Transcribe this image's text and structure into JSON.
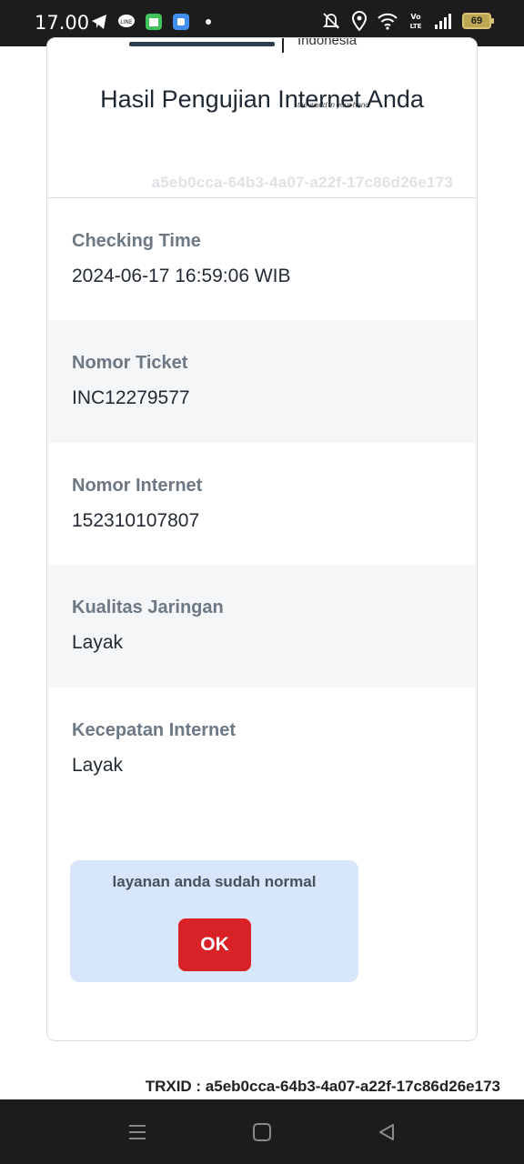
{
  "status_bar": {
    "time": "17.00",
    "battery": "69",
    "icons": [
      "telegram-icon",
      "line-icon",
      "calendar-app-icon",
      "app-icon",
      "dot-icon",
      "mute-icon",
      "location-icon",
      "wifi-icon",
      "volte-icon",
      "signal-icon",
      "battery-icon"
    ]
  },
  "card": {
    "title": "Hasil Pengujian Internet Anda",
    "logo_word": "Indonesia",
    "tagline": "the world in your hand",
    "uuid": "a5eb0cca-64b3-4a07-a22f-17c86d26e173",
    "rows": [
      {
        "label": "Checking Time",
        "value": "2024-06-17 16:59:06 WIB"
      },
      {
        "label": "Nomor Ticket",
        "value": "INC12279577"
      },
      {
        "label": "Nomor Internet",
        "value": "152310107807"
      },
      {
        "label": "Kualitas Jaringan",
        "value": "Layak"
      },
      {
        "label": "Kecepatan Internet",
        "value": "Layak"
      }
    ]
  },
  "alert": {
    "message": "layanan anda sudah normal",
    "ok_label": "OK"
  },
  "footer": {
    "trxid": "TRXID : a5eb0cca-64b3-4a07-a22f-17c86d26e173"
  },
  "nav_bar": [
    "menu-icon",
    "home-icon",
    "back-icon"
  ],
  "colors": {
    "ok_button": "#d92128",
    "alert_bg": "#d8e6fb",
    "alt_row_bg": "#f4f6f8",
    "status_bar_bg": "#1c1c1c"
  }
}
